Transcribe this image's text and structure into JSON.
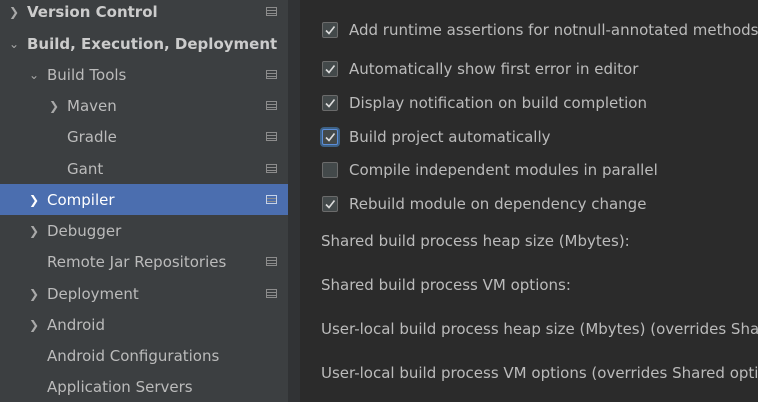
{
  "sidebar": {
    "items": [
      {
        "label": "Version Control",
        "bold": true,
        "arrow": "right"
      },
      {
        "label": "Build, Execution, Deployment",
        "bold": true,
        "arrow": "down"
      },
      {
        "label": "Build Tools",
        "arrow": "down"
      },
      {
        "label": "Maven",
        "arrow": "right"
      },
      {
        "label": "Gradle"
      },
      {
        "label": "Gant"
      },
      {
        "label": "Compiler",
        "arrow": "right",
        "selected": true
      },
      {
        "label": "Debugger",
        "arrow": "right"
      },
      {
        "label": "Remote Jar Repositories"
      },
      {
        "label": "Deployment",
        "arrow": "right"
      },
      {
        "label": "Android",
        "arrow": "right"
      },
      {
        "label": "Android Configurations"
      },
      {
        "label": "Application Servers"
      }
    ]
  },
  "compiler": {
    "checkboxes": [
      {
        "label": "Add runtime assertions for notnull-annotated methods and parameters",
        "checked": true
      },
      {
        "label": "Automatically show first error in editor",
        "checked": true
      },
      {
        "label": "Display notification on build completion",
        "checked": true
      },
      {
        "label": "Build project automatically",
        "checked": true,
        "focused": true
      },
      {
        "label": "Compile independent modules in parallel",
        "checked": false
      },
      {
        "label": "Rebuild module on dependency change",
        "checked": true
      }
    ],
    "fields": [
      {
        "label": "Shared build process heap size (Mbytes):"
      },
      {
        "label": "Shared build process VM options:"
      },
      {
        "label": "User-local build process heap size (Mbytes) (overrides Shared size):"
      },
      {
        "label": "User-local build process VM options (overrides Shared options):"
      }
    ]
  },
  "colors": {
    "selection": "#4b6eaf",
    "sidebar_bg": "#3c3f41",
    "content_bg": "#2b2b2b"
  }
}
